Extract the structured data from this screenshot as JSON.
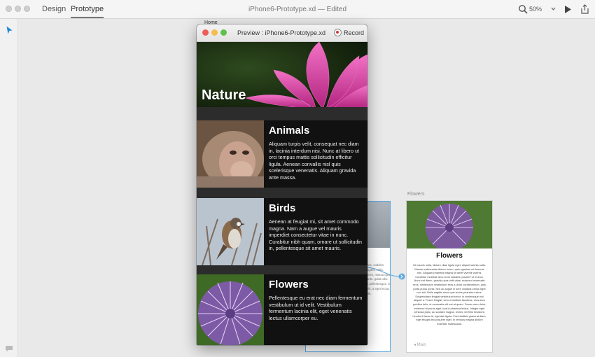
{
  "toolbar": {
    "tabs": [
      {
        "label": "Design"
      },
      {
        "label": "Prototype"
      }
    ],
    "document_title": "iPhone6-Prototype.xd — Edited",
    "zoom": "50%"
  },
  "canvas": {
    "home_artboard_label": "Home",
    "flowers_artboard_label": "Flowers",
    "middle_artboard_text": "nec, sodales agittis, nulla. rices, massa quis ante. gulat odio. n pellentesque. ia elit, a eget lectus elit.",
    "flowers_artboard": {
      "title": "Flowers",
      "body": "Ut mauris nulla, dictum vitae ligula eget, aliquet lacinia nulla. Mauris malesuada dictum lorem, quis egestas mi rhoncus non. Aliquam pharetra magna sit amet viverra viverra. Curabitur molestie arcu at mi sodales posuere ut in arcu. Nunc est libero, gravida quis velit vitae, euismod venenatis eros. Vestibulum vestibulum eros a dolor condimentum, quis porta purus porta. Sed ac augue in sem volutpat varius eget non elit. Nulla sagittis risus quis lectus pharetra luctus. Suspendisse feugiat vestibulum tortor, in scelerisque nisi aliquet a. Fusce feugiat, sem et facilisis faucibus, eros arcu porttitor felis, ut venenatis elit est at quam. Donec sem dolor, euismod at purus eget, luctus pharetra lectus. Integer eget vehicula justo, ac sodales magna. Donec vel felis tincidunt, hendrerit lacus id, egestas ligula. Cras facilisis placerat diam, eget feugiat leo posuere eget. In tempus magna dictum molestie malesuada.",
      "back_link": "◂ Main"
    }
  },
  "preview": {
    "title": "Preview : iPhone6-Prototype.xd",
    "record_label": "Record",
    "hero_title": "Nature",
    "sections": [
      {
        "title": "Animals",
        "body": "Aliquam turpis velit, consequat nec diam in, lacinia interdum nisi. Nunc at libero ut orci tempus mattis sollicitudin efficitur ligula. Aenean convallis nisl quis scelerisque venenatis. Aliquam gravida ante massa."
      },
      {
        "title": "Birds",
        "body": "Aenean at feugiat mi, sit amet commodo magna. Nam a augue vel mauris imperdiet consectetur vitae in nunc. Curabitur nibh quam, ornare ut sollicitudin in, pellentesque sit amet mauris."
      },
      {
        "title": "Flowers",
        "body": "Pellentesque eu erat nec diam fermentum vestibulum ut id velit. Vestibulum fermentum lacinia elit, eget venenatis lectus ullamcorper eu."
      }
    ]
  },
  "colors": {
    "accent_blue": "#1d8ad8",
    "record_red": "#d13b3b",
    "preview_background": "#111111"
  }
}
